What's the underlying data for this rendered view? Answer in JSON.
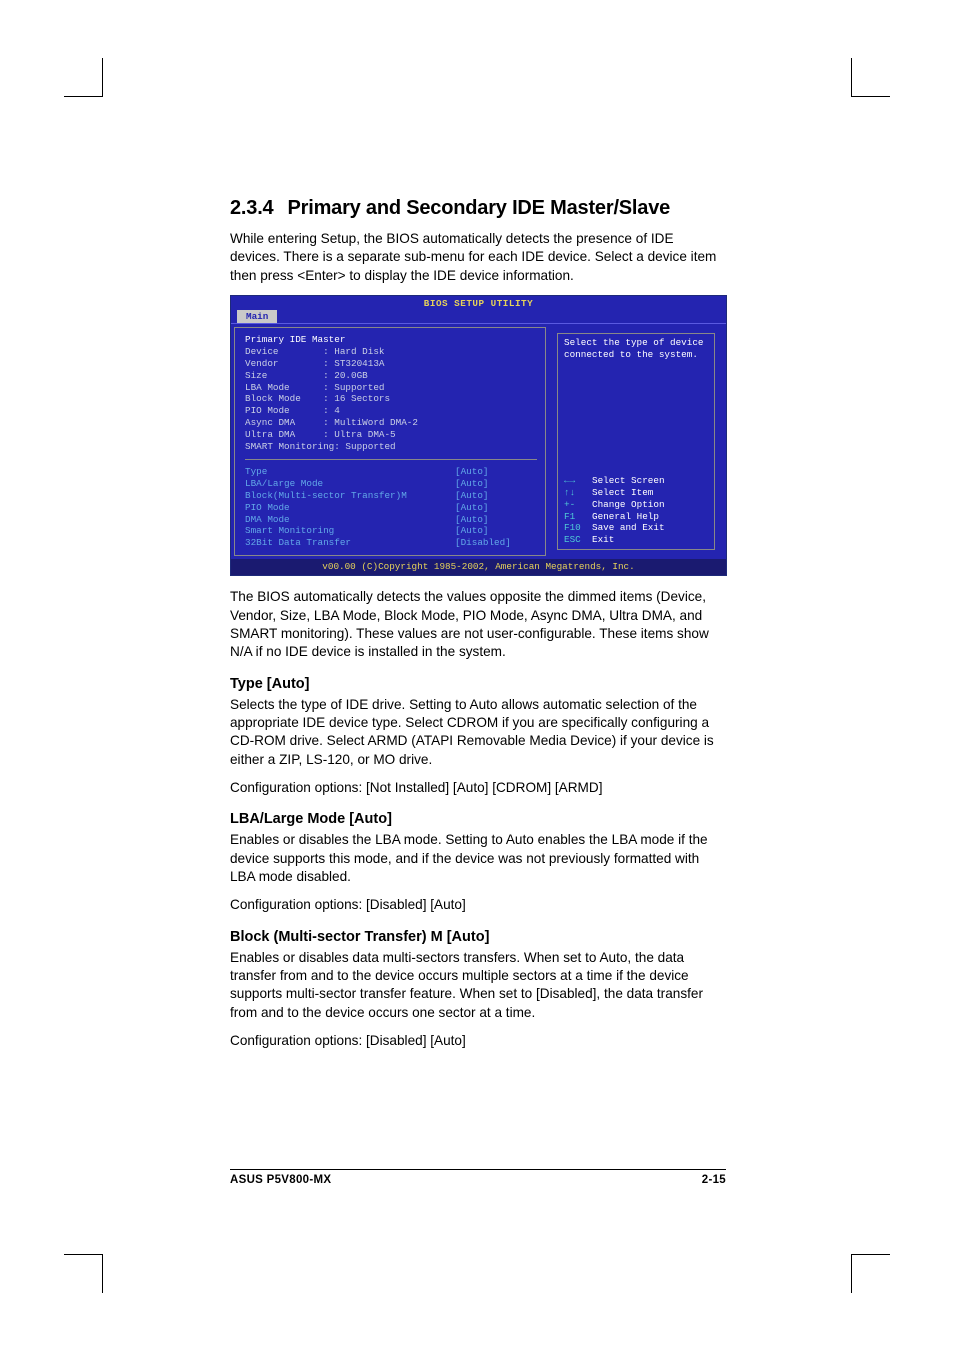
{
  "section": {
    "number": "2.3.4",
    "title": "Primary and Secondary IDE Master/Slave"
  },
  "intro": "While entering Setup, the BIOS automatically detects the presence of IDE devices. There is a separate sub-menu for each IDE device. Select a device item then press <Enter> to display the IDE device information.",
  "bios": {
    "title": "BIOS SETUP UTILITY",
    "tab": "Main",
    "header": "Primary IDE Master",
    "info": {
      "Device": "Hard Disk",
      "Vendor": "ST320413A",
      "Size": "20.0GB",
      "LBA Mode": "Supported",
      "Block Mode": "16 Sectors",
      "PIO Mode": "4",
      "Async DMA": "MultiWord DMA-2",
      "Ultra DMA": "Ultra DMA-5",
      "SMART": "SMART Monitoring: Supported"
    },
    "options": [
      {
        "name": "Type",
        "value": "[Auto]"
      },
      {
        "name": "LBA/Large Mode",
        "value": "[Auto]"
      },
      {
        "name": "Block(Multi-sector Transfer)M",
        "value": "[Auto]"
      },
      {
        "name": "PIO Mode",
        "value": "[Auto]"
      },
      {
        "name": "DMA Mode",
        "value": "[Auto]"
      },
      {
        "name": "Smart Monitoring",
        "value": "[Auto]"
      },
      {
        "name": "32Bit Data Transfer",
        "value": "[Disabled]"
      }
    ],
    "help": "Select the type of device connected to the system.",
    "nav": [
      {
        "sym": "←→",
        "label": "Select Screen"
      },
      {
        "sym": "↑↓",
        "label": "Select Item"
      },
      {
        "sym": "+-",
        "label": "Change Option"
      },
      {
        "sym": "F1",
        "label": "General Help"
      },
      {
        "sym": "F10",
        "label": "Save and Exit"
      },
      {
        "sym": "ESC",
        "label": "Exit"
      }
    ],
    "copyright": "v00.00 (C)Copyright 1985-2002, American Megatrends, Inc."
  },
  "after_bios": "The BIOS automatically detects the values opposite the dimmed items (Device, Vendor, Size, LBA Mode, Block Mode, PIO Mode, Async DMA, Ultra DMA, and SMART monitoring). These values are not user-configurable. These items show N/A if no IDE device is installed in the system.",
  "subs": {
    "type": {
      "heading": "Type [Auto]",
      "body": "Selects the type of IDE drive. Setting to Auto allows automatic selection of the appropriate IDE device type. Select CDROM if you are specifically configuring a CD-ROM drive. Select ARMD (ATAPI Removable Media Device) if your device is either a ZIP, LS-120, or MO drive.",
      "conf": "Configuration options: [Not Installed] [Auto] [CDROM] [ARMD]"
    },
    "lba": {
      "heading": "LBA/Large Mode [Auto]",
      "body": "Enables or disables the LBA mode. Setting to Auto enables the LBA mode if the device supports this mode, and if the device was not previously formatted with LBA mode disabled.",
      "conf": "Configuration options: [Disabled] [Auto]"
    },
    "block": {
      "heading": "Block (Multi-sector Transfer) M [Auto]",
      "body": "Enables or disables data multi-sectors transfers. When set to Auto, the data transfer from and to the device occurs multiple sectors at a time if the device supports multi-sector transfer feature. When set to [Disabled], the data transfer from and to the device occurs one sector at a time.",
      "conf": "Configuration options: [Disabled] [Auto]"
    }
  },
  "footer": {
    "left": "ASUS P5V800-MX",
    "right": "2-15"
  }
}
